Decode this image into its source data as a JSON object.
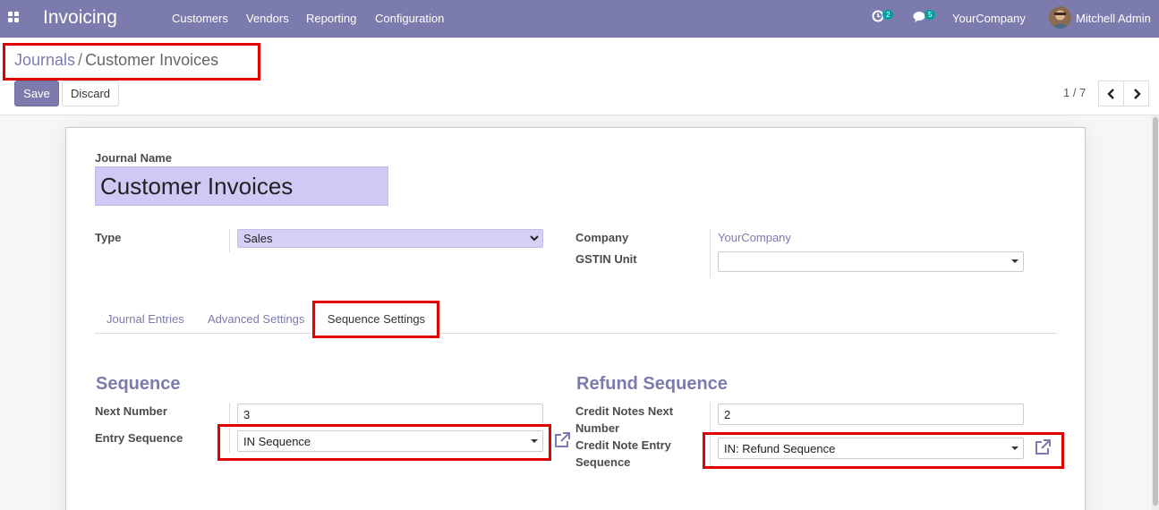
{
  "navbar": {
    "app_title": "Invoicing",
    "menus": [
      "Customers",
      "Vendors",
      "Reporting",
      "Configuration"
    ],
    "activity_badge": "2",
    "messages_badge": "5",
    "company": "YourCompany",
    "user": "Mitchell Admin"
  },
  "breadcrumb": {
    "parent": "Journals",
    "separator": "/",
    "current": "Customer Invoices"
  },
  "toolbar": {
    "save_label": "Save",
    "discard_label": "Discard"
  },
  "pager": {
    "value": "1 / 7"
  },
  "form": {
    "journal_name_label": "Journal Name",
    "journal_name_value": "Customer Invoices",
    "type_label": "Type",
    "type_value": "Sales",
    "company_label": "Company",
    "company_value": "YourCompany",
    "gstin_label": "GSTIN Unit",
    "gstin_value": ""
  },
  "tabs": [
    {
      "label": "Journal Entries"
    },
    {
      "label": "Advanced Settings"
    },
    {
      "label": "Sequence Settings"
    }
  ],
  "sequence": {
    "title": "Sequence",
    "next_number_label": "Next Number",
    "next_number_value": "3",
    "entry_sequence_label": "Entry Sequence",
    "entry_sequence_value": "IN Sequence"
  },
  "refund": {
    "title": "Refund Sequence",
    "next_number_label_1": "Credit Notes Next",
    "next_number_label_2": "Number",
    "next_number_value": "2",
    "entry_label_1": "Credit Note Entry",
    "entry_label_2": "Sequence",
    "entry_value": "IN: Refund Sequence"
  },
  "colors": {
    "navbar": "#7c7bad",
    "accent": "#7c7bad",
    "highlight": "#e00000",
    "badge": "#00a09d"
  },
  "icons": [
    "apps-grid-icon",
    "activity-clock-icon",
    "messages-icon",
    "chevron-left-icon",
    "chevron-right-icon",
    "external-link-icon",
    "caret-down-icon"
  ]
}
